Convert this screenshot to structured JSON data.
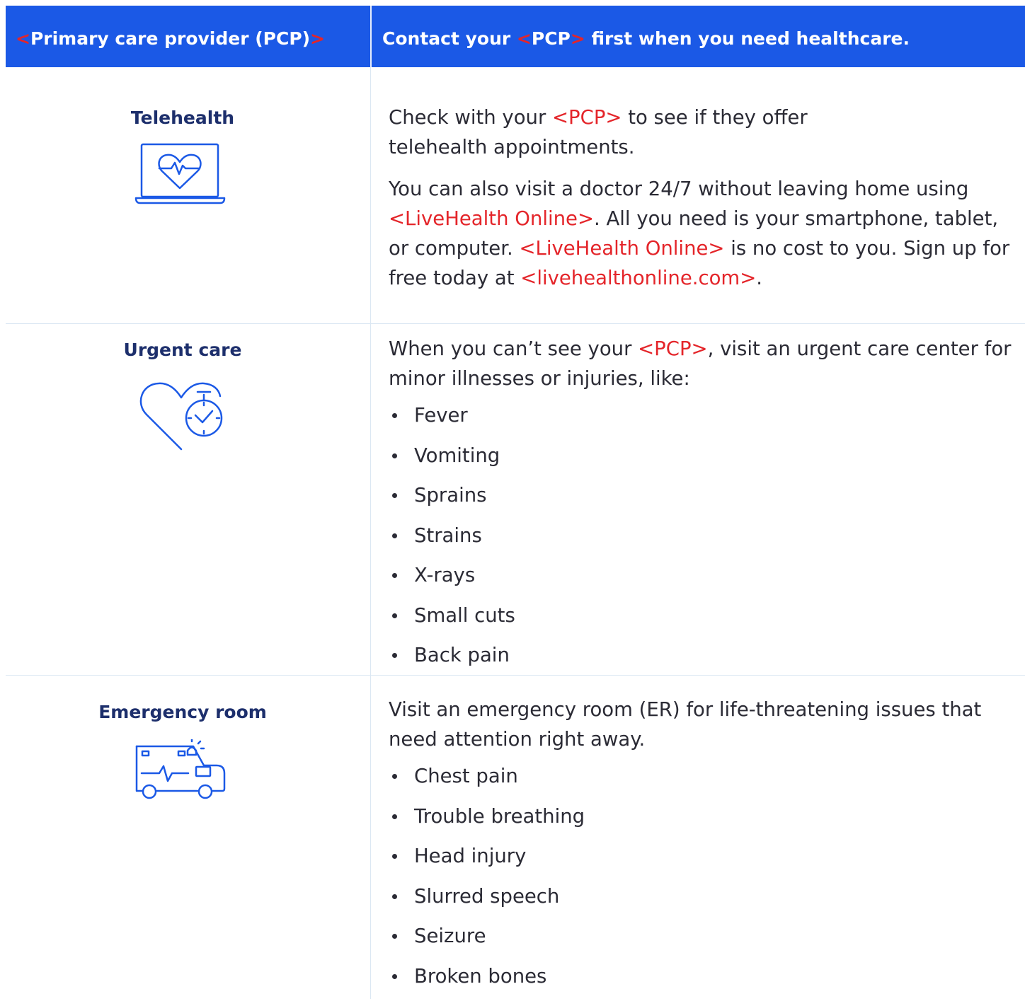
{
  "header": {
    "left": {
      "open": "<",
      "label": "Primary care provider (PCP)",
      "close": ">"
    },
    "right": {
      "before": "Contact your ",
      "open": "<",
      "pcp": "PCP",
      "close": ">",
      "after": " first when you need healthcare."
    }
  },
  "telehealth": {
    "title": "Telehealth",
    "icon": "laptop-heart-pulse-icon",
    "p1": {
      "before": "Check with your ",
      "pcp": "<PCP>",
      "after": " to see if they offer telehealth appointments."
    },
    "p2": {
      "t1": "You can also visit a doctor 24/7 without leaving home using ",
      "brand1": "<LiveHealth Online>",
      "t2": ". All you need is your smartphone, tablet, or computer. ",
      "brand2": "<LiveHealth Online>",
      "t3": " is no cost to you. Sign up for free today at ",
      "url": "<livehealthonline.com>",
      "t4": "."
    }
  },
  "urgent_care": {
    "title": "Urgent care",
    "icon": "heart-stopwatch-icon",
    "intro": {
      "before": "When you can’t see your ",
      "pcp": "<PCP>",
      "after": ", visit an urgent care center for minor illnesses or injuries, like:"
    },
    "items": [
      "Fever",
      "Vomiting",
      "Sprains",
      "Strains",
      "X-rays",
      "Small cuts",
      "Back pain"
    ]
  },
  "emergency": {
    "title": "Emergency room",
    "icon": "ambulance-icon",
    "intro": "Visit an emergency room (ER) for life-threatening issues that need attention right away.",
    "items": [
      "Chest pain",
      "Trouble breathing",
      "Head injury",
      "Slurred speech",
      "Seizure",
      "Broken bones"
    ]
  },
  "colors": {
    "header_bg": "#1b59e6",
    "title": "#1d2f6c",
    "icon": "#1b59e6",
    "placeholder": "#e4252a",
    "body_text": "#2b2b35",
    "rule": "#dbe7f3"
  }
}
